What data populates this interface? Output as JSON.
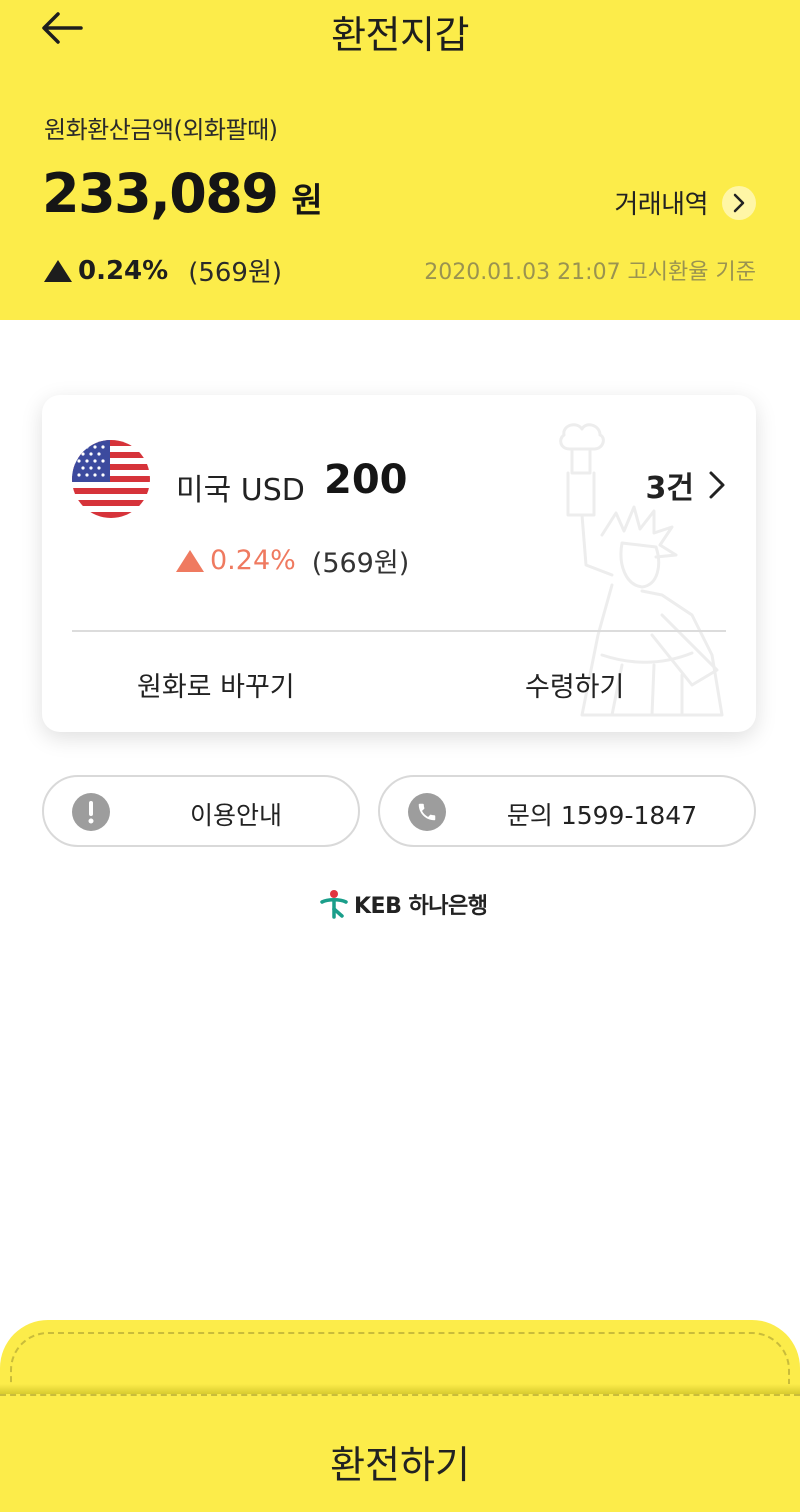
{
  "header": {
    "title": "환전지갑",
    "summary_label": "원화환산금액(외화팔때)",
    "amount_value": "233,089",
    "amount_unit": "원",
    "history_label": "거래내역",
    "change_rate": "0.24%",
    "change_amount": "(569원)",
    "rate_basis": "2020.01.03 21:07 고시환율 기준"
  },
  "wallet_card": {
    "currency_name": "미국 USD",
    "currency_amount": "200",
    "count_label": "3건",
    "change_rate": "0.24%",
    "change_amount": "(569원)",
    "convert_label": "원화로 바꾸기",
    "receive_label": "수령하기",
    "flag_icon": "us-flag-icon",
    "background_icon": "statue-of-liberty-icon"
  },
  "info_buttons": {
    "guide_label": "이용안내",
    "contact_label": "문의 1599-1847"
  },
  "bank": {
    "name": "KEB 하나은행"
  },
  "cta": {
    "label": "환전하기"
  },
  "colors": {
    "brand_yellow": "#fcec4a",
    "up_red": "#ef7a60",
    "text_dark": "#151515",
    "bank_green": "#1a9e8a"
  }
}
